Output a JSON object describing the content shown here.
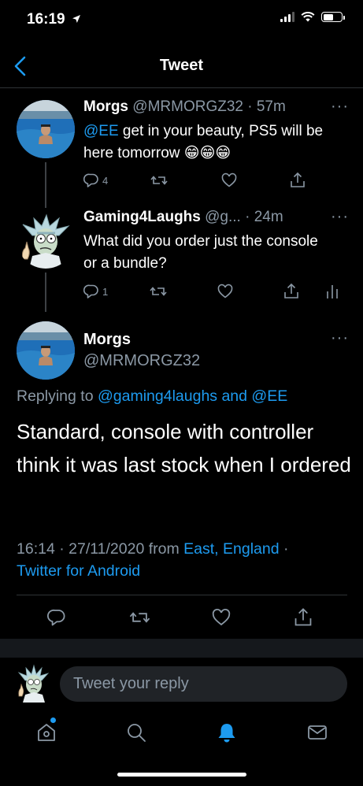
{
  "status_bar": {
    "time": "16:19"
  },
  "nav": {
    "title": "Tweet"
  },
  "thread": [
    {
      "name": "Morgs",
      "handle": "@MRMORGZ32",
      "sep": "·",
      "time": "57m",
      "mention": "@EE",
      "text": " get in your beauty, PS5 will be here tomorrow 😁😁😁",
      "reply_count": "4",
      "avatar": "pool-photo"
    },
    {
      "name": "Gaming4Laughs",
      "handle": "@g...",
      "sep": "·",
      "time": "24m",
      "text": "What did you order just the console or a bundle?",
      "reply_count": "1",
      "avatar": "rick-cartoon"
    }
  ],
  "main": {
    "name": "Morgs",
    "handle": "@MRMORGZ32",
    "replying_prefix": "Replying to",
    "replying_to": "@gaming4laughs and @EE",
    "text": "Standard, console with controller think it was last stock when I ordered",
    "time": "16:14",
    "date": "27/11/2020",
    "from_label": "from",
    "location": "East, England",
    "client": "Twitter for Android",
    "dot": "·"
  },
  "reply": {
    "placeholder": "Tweet your reply"
  },
  "icons": {
    "more": "more-icon",
    "reply": "reply-icon",
    "retweet": "retweet-icon",
    "like": "like-icon",
    "share": "share-icon",
    "analytics": "analytics-icon",
    "tabs": [
      "home-icon",
      "search-icon",
      "notifications-icon",
      "messages-icon"
    ]
  },
  "colors": {
    "accent": "#1d9bf0",
    "muted": "#8b98a5",
    "background": "#000000",
    "divider": "#2f3336"
  }
}
